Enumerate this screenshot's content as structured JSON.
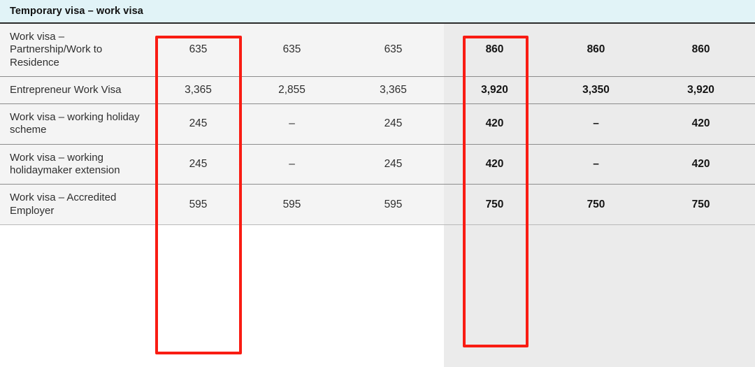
{
  "table": {
    "section_title": "Temporary visa – work visa",
    "columns": [
      {
        "key": "label",
        "label": ""
      },
      {
        "key": "c1",
        "label": ""
      },
      {
        "key": "c2",
        "label": ""
      },
      {
        "key": "c3",
        "label": ""
      },
      {
        "key": "c4",
        "label": ""
      },
      {
        "key": "c5",
        "label": ""
      },
      {
        "key": "c6",
        "label": ""
      }
    ],
    "rows": [
      {
        "label": "Work visa – Partnership/Work to Residence",
        "values": [
          "635",
          "635",
          "635",
          "860",
          "860",
          "860"
        ]
      },
      {
        "label": "Entrepreneur Work Visa",
        "values": [
          "3,365",
          "2,855",
          "3,365",
          "3,920",
          "3,350",
          "3,920"
        ]
      },
      {
        "label": "Work visa – working holiday scheme",
        "values": [
          "245",
          "–",
          "245",
          "420",
          "–",
          "420"
        ]
      },
      {
        "label": "Work visa – working holidaymaker extension",
        "values": [
          "245",
          "–",
          "245",
          "420",
          "–",
          "420"
        ]
      },
      {
        "label": "Work visa – Accredited Employer",
        "values": [
          "595",
          "595",
          "595",
          "750",
          "750",
          "750"
        ]
      }
    ]
  },
  "annotations": {
    "highlight_color": "#f91c13",
    "boxes": [
      {
        "name": "highlight-column-1",
        "column_index": 1
      },
      {
        "name": "highlight-column-4",
        "column_index": 4
      }
    ]
  },
  "colors": {
    "section_header_bg": "#e1f3f7",
    "row_bg": "#f4f4f4",
    "shaded_group_bg": "#ebebeb",
    "rule": "#8c8c8c",
    "text": "#2f2f2f",
    "bold_text": "#141414"
  }
}
